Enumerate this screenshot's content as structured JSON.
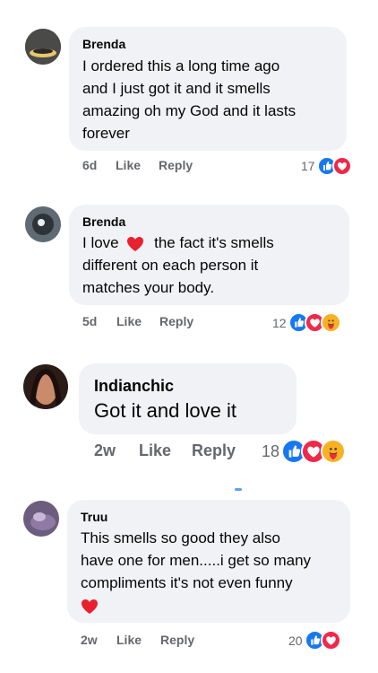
{
  "comments": [
    {
      "author": "Brenda",
      "lines": [
        "I ordered this a long time ago",
        "and I just got it and it smells",
        "amazing oh my God and it lasts",
        "forever"
      ],
      "time": "6d",
      "like_label": "Like",
      "reply_label": "Reply",
      "reaction_count": "17",
      "reactions": [
        "like-icon",
        "love-icon"
      ]
    },
    {
      "author": "Brenda",
      "lines_pre": "I love",
      "lines_post": "the fact it's smells",
      "lines": [
        "different on each person it",
        "matches your body."
      ],
      "inline_emoji": "red-heart-emoji",
      "time": "5d",
      "like_label": "Like",
      "reply_label": "Reply",
      "reaction_count": "12",
      "reactions": [
        "like-icon",
        "love-icon",
        "care-icon"
      ]
    },
    {
      "author": "Indianchic",
      "lines": [
        "Got it and love it"
      ],
      "time": "2w",
      "like_label": "Like",
      "reply_label": "Reply",
      "reaction_count": "18",
      "reactions": [
        "like-icon",
        "love-icon",
        "care-icon"
      ]
    },
    {
      "author": "Truu",
      "lines": [
        "This smells so good they also",
        "have one for men.....i get so many",
        "compliments it's not even funny"
      ],
      "trailing_emoji": "red-heart-emoji",
      "time": "2w",
      "like_label": "Like",
      "reply_label": "Reply",
      "reaction_count": "20",
      "reactions": [
        "like-icon",
        "love-icon"
      ]
    }
  ],
  "colors": {
    "bubble": "#f0f2f5",
    "meta_text": "#65676b",
    "like_blue": "#1877f2",
    "love_red": "#f02849",
    "care_yellow": "#f7b125"
  }
}
